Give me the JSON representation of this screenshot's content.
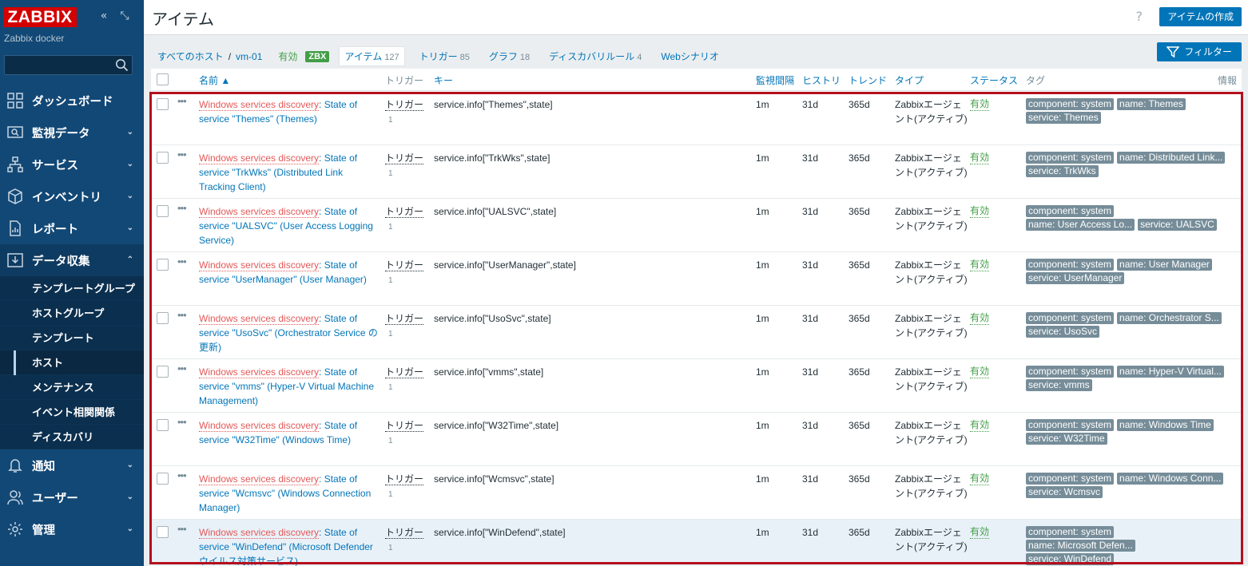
{
  "sidebar": {
    "logo": "ZABBIX",
    "instance": "Zabbix docker",
    "search_placeholder": "",
    "menu": [
      {
        "label": "ダッシュボード",
        "icon": "dashboard-icon"
      },
      {
        "label": "監視データ",
        "icon": "monitoring-icon"
      },
      {
        "label": "サービス",
        "icon": "services-icon"
      },
      {
        "label": "インベントリ",
        "icon": "inventory-icon"
      },
      {
        "label": "レポート",
        "icon": "reports-icon"
      },
      {
        "label": "データ収集",
        "icon": "data-collection-icon"
      }
    ],
    "submenu": [
      "テンプレートグループ",
      "ホストグループ",
      "テンプレート",
      "ホスト",
      "メンテナンス",
      "イベント相関関係",
      "ディスカバリ"
    ],
    "menu_bottom": [
      {
        "label": "通知",
        "icon": "alerts-icon"
      },
      {
        "label": "ユーザー",
        "icon": "users-icon"
      },
      {
        "label": "管理",
        "icon": "administration-icon"
      }
    ]
  },
  "header": {
    "title": "アイテム",
    "help": "?",
    "create_button": "アイテムの作成"
  },
  "breadcrumb": {
    "all_hosts": "すべてのホスト",
    "sep": "/",
    "host": "vm-01",
    "status": "有効",
    "zbx": "ZBX",
    "tabs": [
      {
        "label": "アイテム",
        "count": "127"
      },
      {
        "label": "トリガー",
        "count": "85"
      },
      {
        "label": "グラフ",
        "count": "18"
      },
      {
        "label": "ディスカバリルール",
        "count": "4"
      },
      {
        "label": "Webシナリオ",
        "count": ""
      }
    ],
    "filter_button": "フィルター"
  },
  "columns": {
    "name": "名前 ▲",
    "triggers": "トリガー",
    "key": "キー",
    "interval": "監視間隔",
    "history": "ヒストリ",
    "trends": "トレンド",
    "type": "タイプ",
    "status": "ステータス",
    "tags": "タグ",
    "info": "情報"
  },
  "rows": [
    {
      "prefix": "Windows services discovery",
      "name": ": State of service \"Themes\" (Themes)",
      "trigger": "トリガー",
      "trigger_count": "1",
      "key": "service.info[\"Themes\",state]",
      "interval": "1m",
      "history": "31d",
      "trends": "365d",
      "type": "Zabbixエージェント(アクティブ)",
      "status": "有効",
      "tags": [
        "component: system",
        "name: Themes",
        "service: Themes"
      ]
    },
    {
      "prefix": "Windows services discovery",
      "name": ": State of service \"TrkWks\" (Distributed Link Tracking Client)",
      "trigger": "トリガー",
      "trigger_count": "1",
      "key": "service.info[\"TrkWks\",state]",
      "interval": "1m",
      "history": "31d",
      "trends": "365d",
      "type": "Zabbixエージェント(アクティブ)",
      "status": "有効",
      "tags": [
        "component: system",
        "name: Distributed Link...",
        "service: TrkWks"
      ]
    },
    {
      "prefix": "Windows services discovery",
      "name": ": State of service \"UALSVC\" (User Access Logging Service)",
      "trigger": "トリガー",
      "trigger_count": "1",
      "key": "service.info[\"UALSVC\",state]",
      "interval": "1m",
      "history": "31d",
      "trends": "365d",
      "type": "Zabbixエージェント(アクティブ)",
      "status": "有効",
      "tags": [
        "component: system",
        "name: User Access Lo...",
        "service: UALSVC"
      ]
    },
    {
      "prefix": "Windows services discovery",
      "name": ": State of service \"UserManager\" (User Manager)",
      "trigger": "トリガー",
      "trigger_count": "1",
      "key": "service.info[\"UserManager\",state]",
      "interval": "1m",
      "history": "31d",
      "trends": "365d",
      "type": "Zabbixエージェント(アクティブ)",
      "status": "有効",
      "tags": [
        "component: system",
        "name: User Manager",
        "service: UserManager"
      ]
    },
    {
      "prefix": "Windows services discovery",
      "name": ": State of service \"UsoSvc\" (Orchestrator Service の更新)",
      "trigger": "トリガー",
      "trigger_count": "1",
      "key": "service.info[\"UsoSvc\",state]",
      "interval": "1m",
      "history": "31d",
      "trends": "365d",
      "type": "Zabbixエージェント(アクティブ)",
      "status": "有効",
      "tags": [
        "component: system",
        "name: Orchestrator S...",
        "service: UsoSvc"
      ]
    },
    {
      "prefix": "Windows services discovery",
      "name": ": State of service \"vmms\" (Hyper-V Virtual Machine Management)",
      "trigger": "トリガー",
      "trigger_count": "1",
      "key": "service.info[\"vmms\",state]",
      "interval": "1m",
      "history": "31d",
      "trends": "365d",
      "type": "Zabbixエージェント(アクティブ)",
      "status": "有効",
      "tags": [
        "component: system",
        "name: Hyper-V Virtual...",
        "service: vmms"
      ]
    },
    {
      "prefix": "Windows services discovery",
      "name": ": State of service \"W32Time\" (Windows Time)",
      "trigger": "トリガー",
      "trigger_count": "1",
      "key": "service.info[\"W32Time\",state]",
      "interval": "1m",
      "history": "31d",
      "trends": "365d",
      "type": "Zabbixエージェント(アクティブ)",
      "status": "有効",
      "tags": [
        "component: system",
        "name: Windows Time",
        "service: W32Time"
      ]
    },
    {
      "prefix": "Windows services discovery",
      "name": ": State of service \"Wcmsvc\" (Windows Connection Manager)",
      "trigger": "トリガー",
      "trigger_count": "1",
      "key": "service.info[\"Wcmsvc\",state]",
      "interval": "1m",
      "history": "31d",
      "trends": "365d",
      "type": "Zabbixエージェント(アクティブ)",
      "status": "有効",
      "tags": [
        "component: system",
        "name: Windows Conn...",
        "service: Wcmsvc"
      ]
    },
    {
      "prefix": "Windows services discovery",
      "name": ": State of service \"WinDefend\" (Microsoft Defender ウイルス対策サービス)",
      "trigger": "トリガー",
      "trigger_count": "1",
      "key": "service.info[\"WinDefend\",state]",
      "interval": "1m",
      "history": "31d",
      "trends": "365d",
      "type": "Zabbixエージェント(アクティブ)",
      "status": "有効",
      "tags": [
        "component: system",
        "name: Microsoft Defen...",
        "service: WinDefend"
      ]
    }
  ],
  "colors": {
    "sidebar": "#124876",
    "accent": "#0275b8",
    "enabled": "#429e47",
    "discovery": "#e45959",
    "highlight_border": "#b40f1e"
  }
}
